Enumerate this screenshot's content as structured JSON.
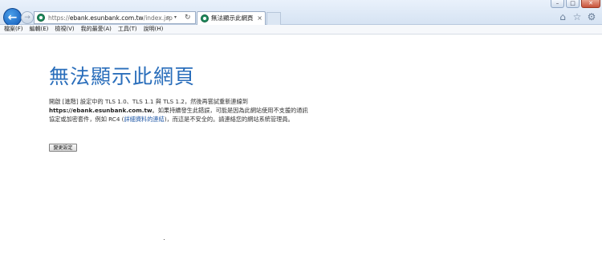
{
  "browser": {
    "window_controls": [
      "minimize",
      "maximize",
      "close"
    ],
    "address": {
      "url_prefix": "https://",
      "url_host": "ebank.esunbank.com.tw",
      "url_path": "/index.jsp",
      "search_icon": "search-icon",
      "refresh_icon": "refresh-icon"
    },
    "tab": {
      "title": "無法顯示此網頁"
    },
    "toolbar_icons": [
      "home-icon",
      "star-icon",
      "gear-icon"
    ]
  },
  "menubar": {
    "items": [
      "檔案(F)",
      "編輯(E)",
      "檢視(V)",
      "我的最愛(A)",
      "工具(T)",
      "說明(H)"
    ]
  },
  "page": {
    "title": "無法顯示此網頁",
    "line1": "開啟 [進階] 設定中的 TLS 1.0、TLS 1.1 與 TLS 1.2，然後再嘗試重新連線到",
    "host": "https://ebank.esunbank.com.tw",
    "line2_rest": "。如果持續發生此錯誤，可能是因為此網站使用不支援的通訊",
    "line3_pre": "協定或加密套件，例如 RC4 (",
    "link_text": "詳細資料的連結",
    "line3_post": ")，而這是不安全的。請連絡您的網站系統管理員。",
    "button_label": "變更設定"
  }
}
